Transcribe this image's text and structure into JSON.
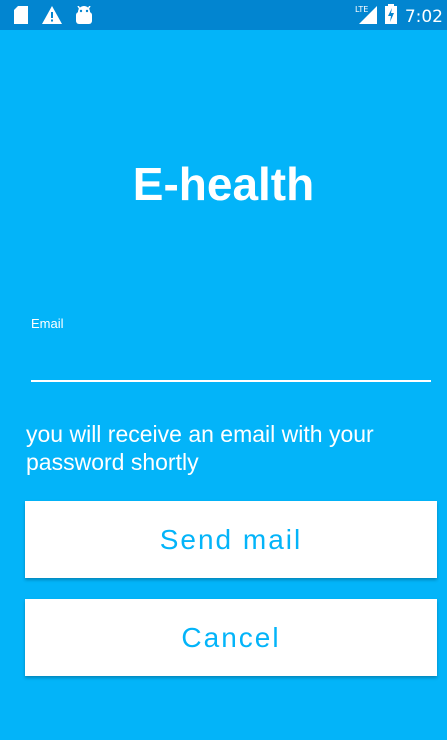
{
  "status_bar": {
    "icons_left": [
      "sd-card-icon",
      "warning-icon",
      "android-icon"
    ],
    "network_label": "LTE",
    "time": "7:02"
  },
  "app": {
    "title": "E-health"
  },
  "form": {
    "email_label": "Email",
    "email_value": "",
    "info_text": "you will receive an email with your password shortly",
    "send_button_label": "Send mail",
    "cancel_button_label": "Cancel"
  },
  "colors": {
    "background": "#03B4F9",
    "status_bar": "#0285D0",
    "button_text": "#03B4F9",
    "button_bg": "#FFFFFF"
  }
}
